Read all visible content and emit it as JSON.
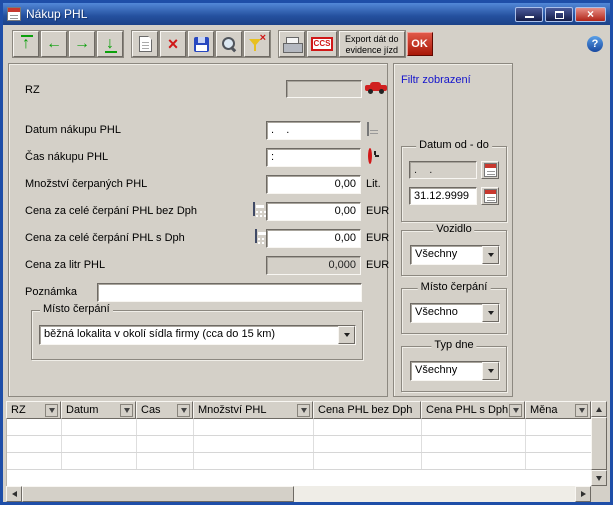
{
  "window": {
    "title": "Nákup PHL"
  },
  "icons": {
    "first": "↑",
    "prev": "←",
    "next": "→",
    "last": "↓",
    "delete": "×",
    "funnel_x": "×",
    "close": "×",
    "help": "?"
  },
  "toolbar": {
    "export_line1": "Export dát do",
    "export_line2": "evidence jízd",
    "ccs": "CCS",
    "ok": "OK"
  },
  "form": {
    "rz_label": "RZ",
    "rz_value": "",
    "datum_label": "Datum nákupu PHL",
    "datum_value": ".    .",
    "cas_label": "Čas nákupu PHL",
    "cas_value": ":",
    "mnozstvi_label": "Množství čerpaných PHL",
    "mnozstvi_value": "0,00",
    "mnozstvi_unit": "Lit.",
    "cena_bez_label": "Cena za celé čerpání PHL bez Dph",
    "cena_bez_value": "0,00",
    "cena_bez_unit": "EUR",
    "cena_s_label": "Cena za celé čerpání PHL s Dph",
    "cena_s_value": "0,00",
    "cena_s_unit": "EUR",
    "cena_litr_label": "Cena za litr PHL",
    "cena_litr_value": "0,000",
    "cena_litr_unit": "EUR",
    "poznamka_label": "Poznámka",
    "poznamka_value": "",
    "misto_group_label": "Místo čerpání",
    "misto_value": "běžná lokalita v okolí sídla firmy (cca do 15 km)"
  },
  "filter": {
    "title": "Filtr zobrazení",
    "datum_group_label": "Datum od - do",
    "datum_from": ".    .",
    "datum_to": "31.12.9999",
    "vozidlo_label": "Vozidlo",
    "vozidlo_value": "Všechny",
    "misto_label": "Místo čerpání",
    "misto_value": "Všechno",
    "typ_label": "Typ dne",
    "typ_value": "Všechny"
  },
  "table": {
    "columns": [
      "RZ",
      "Datum",
      "Cas",
      "Množství PHL",
      "Cena PHL bez Dph",
      "Cena PHL s Dph",
      "Měna"
    ]
  }
}
